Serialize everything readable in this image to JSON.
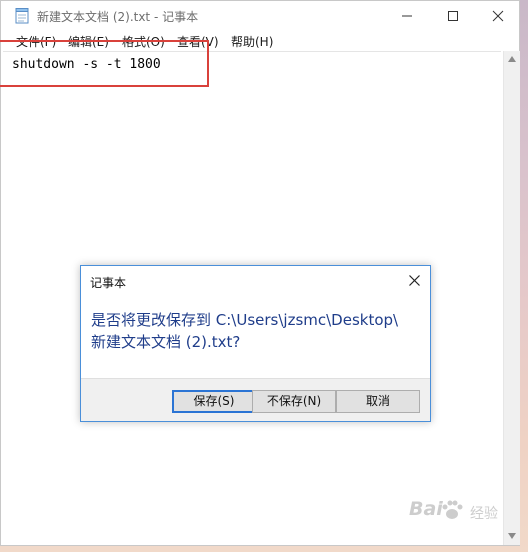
{
  "window": {
    "title": "新建文本文档 (2).txt - 记事本"
  },
  "menu": [
    {
      "label": "文件(F)"
    },
    {
      "label": "编辑(E)"
    },
    {
      "label": "格式(O)"
    },
    {
      "label": "查看(V)"
    },
    {
      "label": "帮助(H)"
    }
  ],
  "editor": {
    "content": "shutdown -s -t 1800"
  },
  "dialog": {
    "title": "记事本",
    "message_line1": "是否将更改保存到 C:\\Users\\jzsmc\\Desktop\\",
    "message_line2": "新建文本文档 (2).txt?",
    "save_label": "保存(S)",
    "nosave_label": "不保存(N)",
    "cancel_label": "取消"
  },
  "watermark": {
    "brand": "Bai",
    "sub": "经验"
  },
  "icons": {
    "app": "notepad-icon",
    "minimize": "minimize-icon",
    "maximize": "maximize-icon",
    "close": "close-icon"
  },
  "colors": {
    "highlight": "#d9413b",
    "dialog_text": "#1f3d8a",
    "primary_button_border": "#2b74d4"
  }
}
